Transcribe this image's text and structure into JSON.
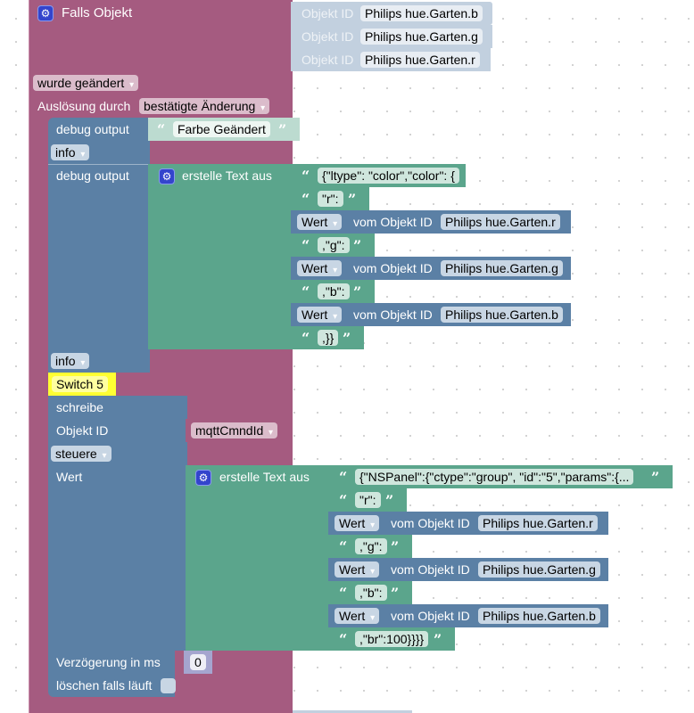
{
  "trigger": {
    "title": "Falls Objekt",
    "settings_icon": "gear-icon",
    "object_ids": [
      {
        "label": "Objekt ID",
        "value": "Philips hue.Garten.b"
      },
      {
        "label": "Objekt ID",
        "value": "Philips hue.Garten.g"
      },
      {
        "label": "Objekt ID",
        "value": "Philips hue.Garten.r"
      }
    ],
    "condition": "wurde geändert",
    "ack_label": "Auslösung durch",
    "ack_value": "bestätigte Änderung"
  },
  "debug1": {
    "label": "debug output",
    "text": "Farbe Geändert",
    "level": "info"
  },
  "debug2": {
    "label": "debug output",
    "create_text_label": "erstelle Text aus",
    "items": [
      {
        "type": "text",
        "value": "{\"ltype\": \"color\",\"color\": {"
      },
      {
        "type": "text",
        "value": "\"r\":"
      },
      {
        "type": "state",
        "mode": "Wert",
        "label": "vom Objekt ID",
        "value": "Philips hue.Garten.r"
      },
      {
        "type": "text",
        "value": ",\"g\":"
      },
      {
        "type": "state",
        "mode": "Wert",
        "label": "vom Objekt ID",
        "value": "Philips hue.Garten.g"
      },
      {
        "type": "text",
        "value": ",\"b\":"
      },
      {
        "type": "state",
        "mode": "Wert",
        "label": "vom Objekt ID",
        "value": "Philips hue.Garten.b"
      },
      {
        "type": "text",
        "value": ",}}"
      }
    ],
    "level": "info"
  },
  "comment": "Switch 5",
  "write": {
    "title": "schreibe",
    "object_label": "Objekt ID",
    "object_var": "mqttCmndId",
    "mode": "steuere",
    "value_label": "Wert",
    "create_text_label": "erstelle Text aus",
    "items": [
      {
        "type": "text",
        "value": "{\"NSPanel\":{\"ctype\":\"group\", \"id\":\"5\",\"params\":{..."
      },
      {
        "type": "text",
        "value": "\"r\":"
      },
      {
        "type": "state",
        "mode": "Wert",
        "label": "vom Objekt ID",
        "value": "Philips hue.Garten.r"
      },
      {
        "type": "text",
        "value": ",\"g\":"
      },
      {
        "type": "state",
        "mode": "Wert",
        "label": "vom Objekt ID",
        "value": "Philips hue.Garten.g"
      },
      {
        "type": "text",
        "value": ",\"b\":"
      },
      {
        "type": "state",
        "mode": "Wert",
        "label": "vom Objekt ID",
        "value": "Philips hue.Garten.b"
      },
      {
        "type": "text",
        "value": ",\"br\":100}}}}"
      }
    ],
    "delay_label": "Verzögerung in ms",
    "delay_value": "0",
    "clear_label": "löschen falls läuft",
    "clear_checked": false
  },
  "colors": {
    "event": "#a55b80",
    "system": "#5b80a5",
    "text": "#5ba58c",
    "comment": "#ffff33"
  }
}
